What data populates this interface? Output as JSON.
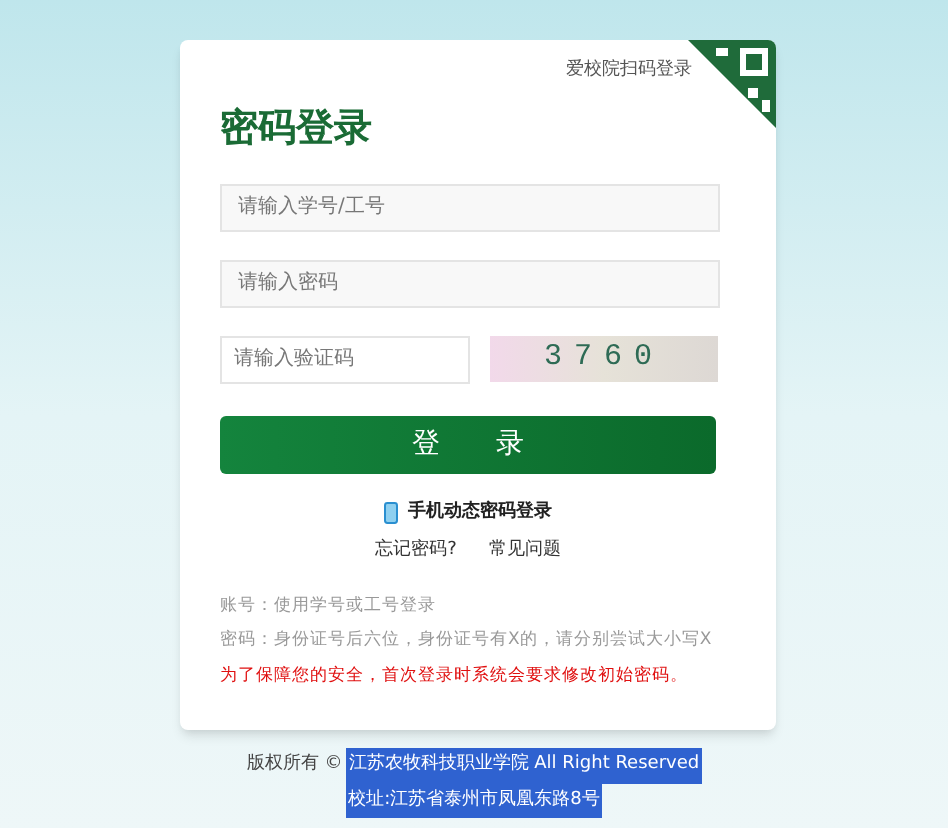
{
  "qr_login_link": "爱校院扫码登录",
  "title": "密码登录",
  "fields": [
    {
      "placeholder": "请输入学号/工号"
    },
    {
      "placeholder": "请输入密码"
    }
  ],
  "captcha": {
    "placeholder": "请输入验证码",
    "code": "3760"
  },
  "login_button": "登　　录",
  "phone_login_link": "手机动态密码登录",
  "links": [
    "忘记密码?",
    "常见问题"
  ],
  "notes": [
    {
      "text": "账号：使用学号或工号登录",
      "kind": "hint"
    },
    {
      "text": "密码：身份证号后六位，身份证号有X的，请分别尝试大小写X",
      "kind": "hint"
    },
    {
      "text": "为了保障您的安全，首次登录时系统会要求修改初始密码。",
      "kind": "warning"
    }
  ],
  "footer": {
    "copyright_label": "版权所有 ©",
    "copyright": "江苏农牧科技职业学院 All Right Reserved",
    "address": "校址:江苏省泰州市凤凰东路8号"
  }
}
